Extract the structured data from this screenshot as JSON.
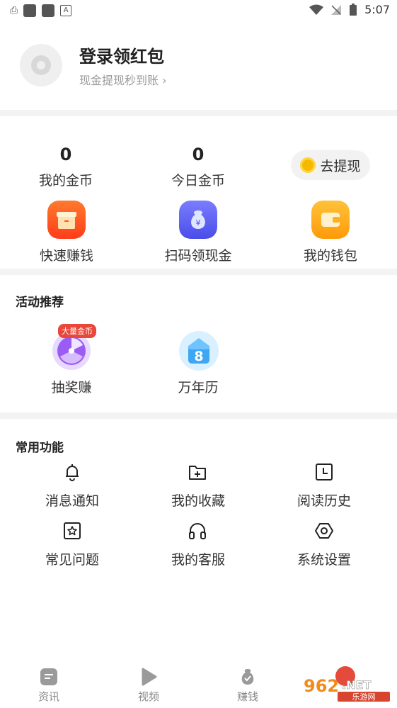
{
  "status_bar": {
    "time": "5:07",
    "left_icons": [
      "notification-icon",
      "app-icon",
      "app-icon",
      "a-icon"
    ],
    "right_icons": [
      "wifi-icon",
      "signal-off-icon",
      "battery-icon"
    ]
  },
  "profile": {
    "title": "登录领红包",
    "subtitle": "现金提现秒到账 ›"
  },
  "stats": {
    "coins_value": "0",
    "coins_label": "我的金币",
    "today_value": "0",
    "today_label": "今日金币",
    "withdraw_label": "去提现"
  },
  "quick_actions": [
    {
      "label": "快速赚钱",
      "icon": "gift-icon",
      "color": "#ff5a1f"
    },
    {
      "label": "扫码领现金",
      "icon": "money-bag-icon",
      "color": "#5b5ef0"
    },
    {
      "label": "我的钱包",
      "icon": "wallet-icon",
      "color": "#ffa814"
    }
  ],
  "activities": {
    "title": "活动推荐",
    "items": [
      {
        "label": "抽奖赚",
        "badge": "大量金币",
        "icon": "lottery-wheel-icon"
      },
      {
        "label": "万年历",
        "badge_number": "8",
        "icon": "calendar-icon"
      }
    ]
  },
  "features": {
    "title": "常用功能",
    "items": [
      {
        "label": "消息通知",
        "icon": "bell-icon"
      },
      {
        "label": "我的收藏",
        "icon": "favorite-folder-icon"
      },
      {
        "label": "阅读历史",
        "icon": "history-icon"
      },
      {
        "label": "常见问题",
        "icon": "star-square-icon"
      },
      {
        "label": "我的客服",
        "icon": "headset-icon"
      },
      {
        "label": "系统设置",
        "icon": "settings-icon"
      }
    ]
  },
  "tabbar": [
    {
      "label": "资讯",
      "icon": "news-icon"
    },
    {
      "label": "视频",
      "icon": "video-icon"
    },
    {
      "label": "赚钱",
      "icon": "earn-icon"
    }
  ],
  "watermark": "962.NET 乐游网"
}
